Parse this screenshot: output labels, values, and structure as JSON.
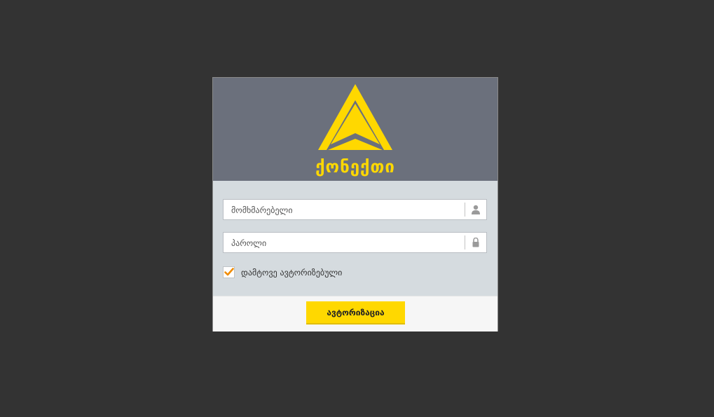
{
  "brand": {
    "name": "ქონექთი",
    "color": "#ffd800"
  },
  "form": {
    "username_placeholder": "მომხმარებელი",
    "password_placeholder": "პაროლი",
    "username_icon": "user-icon",
    "password_icon": "lock-icon",
    "remember_label": "დამტოვე ავტორიზებული",
    "remember_checked": true,
    "checkmark_color": "#f08c00"
  },
  "footer": {
    "login_button": "ავტორიზაცია"
  },
  "colors": {
    "background": "#333333",
    "header": "#6b707c",
    "form_area": "#d5dbdf",
    "footer": "#f6f6f6"
  }
}
